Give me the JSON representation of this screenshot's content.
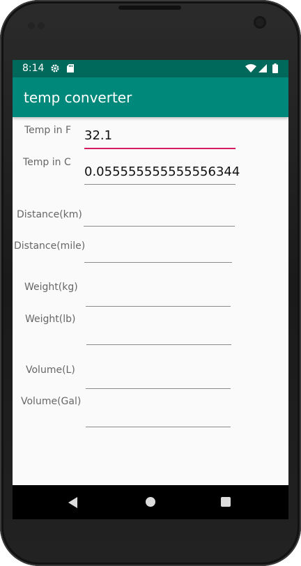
{
  "status_bar": {
    "time": "8:14",
    "icons": [
      "gear-icon",
      "sd-card-icon",
      "wifi-icon",
      "cell-signal-icon",
      "battery-icon"
    ]
  },
  "app_bar": {
    "title": "temp converter"
  },
  "form": {
    "temp_f": {
      "label": "Temp in F",
      "value": "32.1"
    },
    "temp_c": {
      "label": "Temp in C",
      "value": "0.055555555555556344"
    },
    "distance_km": {
      "label": "Distance(km)",
      "value": ""
    },
    "distance_mile": {
      "label": "Distance(mile)",
      "value": ""
    },
    "weight_kg": {
      "label": "Weight(kg)",
      "value": ""
    },
    "weight_lb": {
      "label": "Weight(lb)",
      "value": ""
    },
    "volume_l": {
      "label": "Volume(L)",
      "value": ""
    },
    "volume_gal": {
      "label": "Volume(Gal)",
      "value": ""
    }
  },
  "nav_bar": {
    "buttons": [
      "back-icon",
      "home-icon",
      "recents-icon"
    ]
  },
  "colors": {
    "status_bar": "#00695c",
    "app_bar": "#00897b",
    "focus_underline": "#d81b60"
  }
}
